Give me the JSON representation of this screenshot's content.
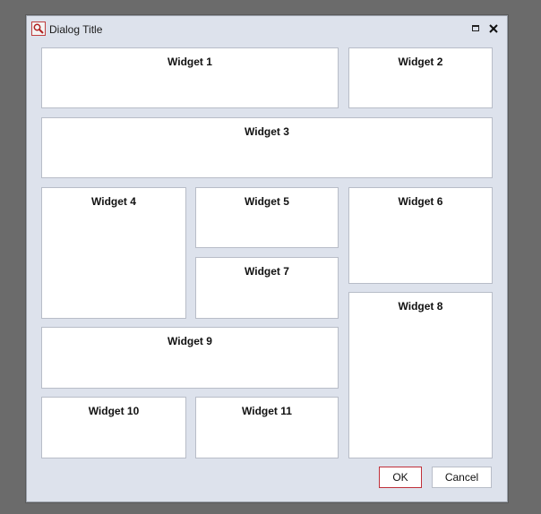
{
  "dialog": {
    "title": "Dialog Title",
    "icon": "magnifier-icon"
  },
  "titlebar_buttons": {
    "maximize_icon": "maximize-icon",
    "close_icon": "close-icon"
  },
  "widgets": [
    {
      "label": "Widget 1"
    },
    {
      "label": "Widget 2"
    },
    {
      "label": "Widget 3"
    },
    {
      "label": "Widget 4"
    },
    {
      "label": "Widget 5"
    },
    {
      "label": "Widget 6"
    },
    {
      "label": "Widget 7"
    },
    {
      "label": "Widget 8"
    },
    {
      "label": "Widget 9"
    },
    {
      "label": "Widget 10"
    },
    {
      "label": "Widget 11"
    }
  ],
  "buttons": {
    "ok_label": "OK",
    "cancel_label": "Cancel"
  },
  "colors": {
    "dialog_background": "#dde2ec",
    "desktop_background": "#6b6b6b",
    "default_button_border": "#c0303a"
  }
}
